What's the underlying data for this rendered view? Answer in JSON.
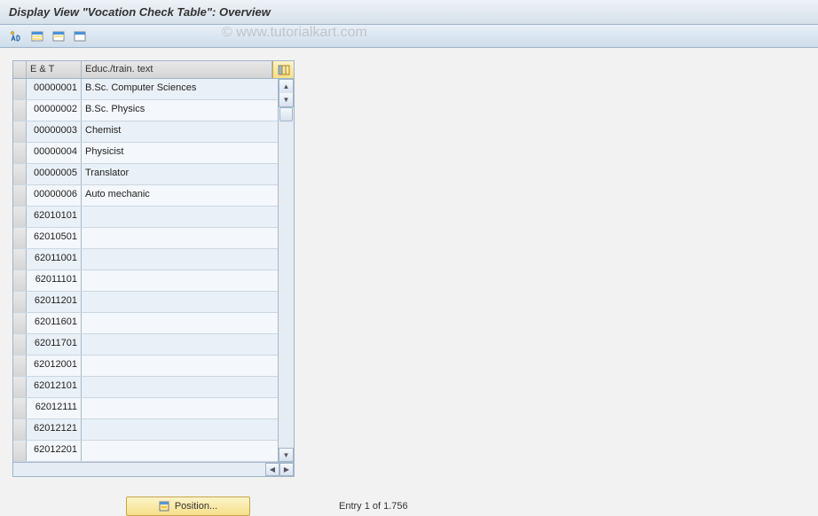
{
  "title": "Display View \"Vocation Check Table\": Overview",
  "watermark": "© www.tutorialkart.com",
  "toolbar": {
    "btn_change": "change-display-icon",
    "btn_select": "select-all-icon",
    "btn_block": "select-block-icon",
    "btn_deselect": "deselect-all-icon"
  },
  "columns": {
    "col1": "E & T",
    "col2": "Educ./train. text"
  },
  "rows": [
    {
      "et": "00000001",
      "txt": "B.Sc. Computer Sciences"
    },
    {
      "et": "00000002",
      "txt": "B.Sc. Physics"
    },
    {
      "et": "00000003",
      "txt": "Chemist"
    },
    {
      "et": "00000004",
      "txt": "Physicist"
    },
    {
      "et": "00000005",
      "txt": "Translator"
    },
    {
      "et": "00000006",
      "txt": "Auto mechanic"
    },
    {
      "et": "62010101",
      "txt": ""
    },
    {
      "et": "62010501",
      "txt": ""
    },
    {
      "et": "62011001",
      "txt": ""
    },
    {
      "et": "62011101",
      "txt": ""
    },
    {
      "et": "62011201",
      "txt": ""
    },
    {
      "et": "62011601",
      "txt": ""
    },
    {
      "et": "62011701",
      "txt": ""
    },
    {
      "et": "62012001",
      "txt": ""
    },
    {
      "et": "62012101",
      "txt": ""
    },
    {
      "et": "62012111",
      "txt": ""
    },
    {
      "et": "62012121",
      "txt": ""
    },
    {
      "et": "62012201",
      "txt": ""
    }
  ],
  "footer": {
    "position_label": "Position...",
    "entry_text": "Entry 1 of 1.756"
  }
}
